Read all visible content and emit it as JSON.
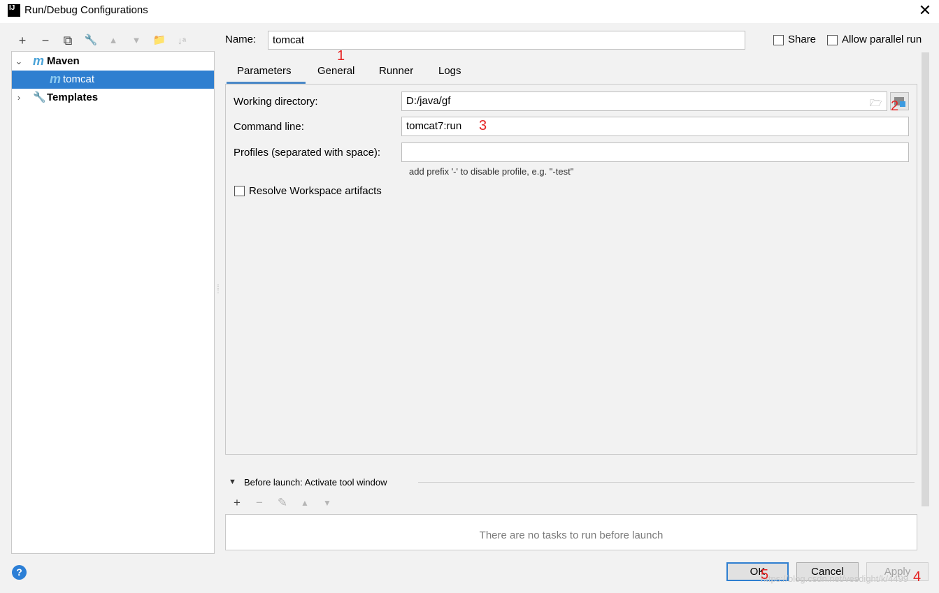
{
  "window": {
    "app_icon": "IJ",
    "title": "Run/Debug Configurations",
    "close": "✕"
  },
  "toolbar": {
    "add": "+",
    "remove": "−",
    "copy": "⧉",
    "edit": "🔧",
    "up": "▲",
    "down": "▼",
    "folder": "📁",
    "sort": "↓ᵃ"
  },
  "tree": {
    "maven_label": "Maven",
    "maven_icon_glyph": "m",
    "tomcat_label": "tomcat",
    "templates_label": "Templates"
  },
  "config": {
    "name_label": "Name:",
    "name_value": "tomcat",
    "share_label": "Share",
    "parallel_label": "Allow parallel run"
  },
  "tabs": [
    "Parameters",
    "General",
    "Runner",
    "Logs"
  ],
  "parameters": {
    "working_dir_label": "Working directory:",
    "working_dir_value": "D:/java/gf",
    "command_line_label": "Command line:",
    "command_line_value": "tomcat7:run",
    "profiles_label": "Profiles (separated with space):",
    "profiles_value": "",
    "profiles_hint": "add prefix '-' to disable profile, e.g. \"-test\"",
    "resolve_label": "Resolve Workspace artifacts"
  },
  "before_launch": {
    "title": "Before launch: Activate tool window",
    "empty_text": "There are no tasks to run before launch",
    "add": "+",
    "remove": "−",
    "edit": "✎",
    "up": "▲",
    "down": "▼"
  },
  "buttons": {
    "help": "?",
    "ok": "OK",
    "cancel": "Cancel",
    "apply": "Apply"
  },
  "annotations": [
    "1",
    "2",
    "3",
    "4",
    "5"
  ],
  "watermark": "https://blog.csdn.net/vesdight/k/4499",
  "colors": {
    "selection": "#2f7fd0",
    "annotation": "#e52121",
    "tab_underline": "#4a88c7"
  }
}
